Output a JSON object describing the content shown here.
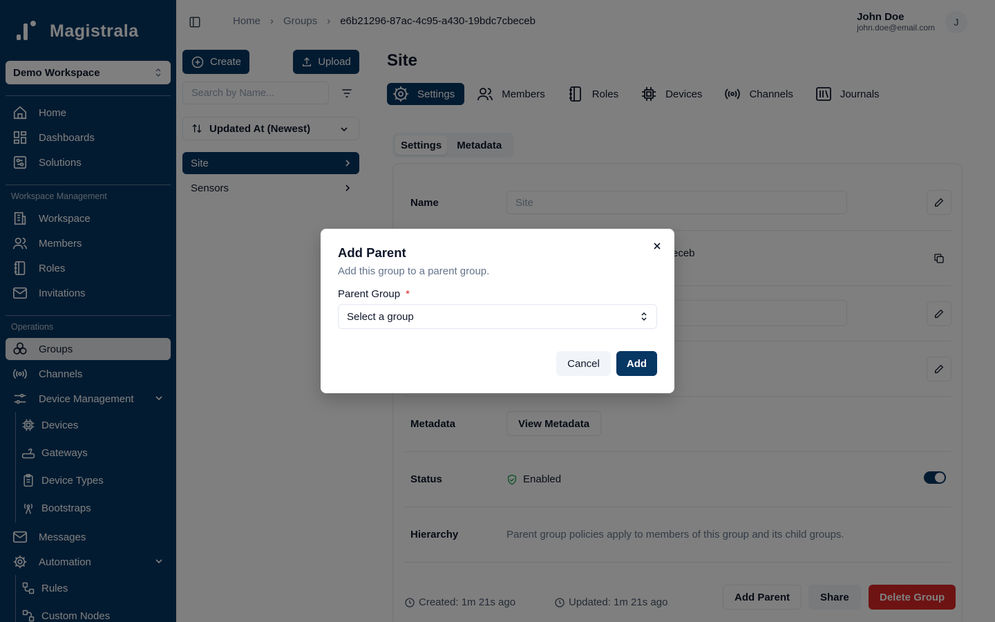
{
  "app": {
    "name": "Magistrala"
  },
  "workspace": {
    "selected": "Demo Workspace"
  },
  "sidebar": {
    "top_items": [
      {
        "label": "Home",
        "icon": "home-icon"
      },
      {
        "label": "Dashboards",
        "icon": "dashboard-icon"
      },
      {
        "label": "Solutions",
        "icon": "solutions-icon"
      }
    ],
    "section_workspace": "Workspace Management",
    "workspace_items": [
      {
        "label": "Workspace",
        "icon": "building-icon"
      },
      {
        "label": "Members",
        "icon": "users-icon"
      },
      {
        "label": "Roles",
        "icon": "notebook-icon"
      },
      {
        "label": "Invitations",
        "icon": "mail-icon"
      }
    ],
    "section_operations": "Operations",
    "operations_items": [
      {
        "label": "Groups",
        "icon": "groups-icon",
        "active": true
      },
      {
        "label": "Channels",
        "icon": "broadcast-icon"
      },
      {
        "label": "Device Management",
        "icon": "sliders-icon"
      }
    ],
    "device_sub_items": [
      {
        "label": "Devices",
        "icon": "cpu-icon"
      },
      {
        "label": "Gateways",
        "icon": "router-icon"
      },
      {
        "label": "Device Types",
        "icon": "clipboard-icon"
      },
      {
        "label": "Bootstraps",
        "icon": "antenna-icon"
      }
    ],
    "messages_label": "Messages",
    "automation_label": "Automation",
    "automation_sub_items": [
      {
        "label": "Rules",
        "icon": "rules-icon"
      },
      {
        "label": "Custom Nodes",
        "icon": "nodes-icon"
      }
    ]
  },
  "header": {
    "breadcrumbs": [
      "Home",
      "Groups",
      "e6b21296-87ac-4c95-a430-19bdc7cbeceb"
    ],
    "user_name": "John Doe",
    "user_email": "john.doe@email.com",
    "avatar_initial": "J"
  },
  "list_panel": {
    "create_label": "Create",
    "upload_label": "Upload",
    "search_placeholder": "Search by Name...",
    "sort_label": "Updated At (Newest)",
    "items": [
      "Site",
      "Sensors"
    ]
  },
  "main": {
    "title": "Site",
    "tabs": [
      "Settings",
      "Members",
      "Roles",
      "Devices",
      "Channels",
      "Journals"
    ],
    "sub_tabs": [
      "Settings",
      "Metadata"
    ],
    "name_label": "Name",
    "name_placeholder": "Site",
    "id_value_partial": "eceb",
    "metadata_label": "Metadata",
    "view_metadata_label": "View Metadata",
    "status_label": "Status",
    "status_value": "Enabled",
    "hierarchy_label": "Hierarchy",
    "hierarchy_text": "Parent group policies apply to members of this group and its child groups.",
    "created": "Created: 1m 21s ago",
    "updated": "Updated: 1m 21s ago",
    "add_parent_label": "Add Parent",
    "share_label": "Share",
    "delete_label": "Delete Group"
  },
  "modal": {
    "title": "Add Parent",
    "description": "Add this group to a parent group.",
    "field_label": "Parent Group",
    "required_mark": "*",
    "select_placeholder": "Select a group",
    "cancel_label": "Cancel",
    "add_label": "Add"
  },
  "colors": {
    "brand": "#073763",
    "danger": "#dc2626",
    "success": "#16a34a"
  }
}
